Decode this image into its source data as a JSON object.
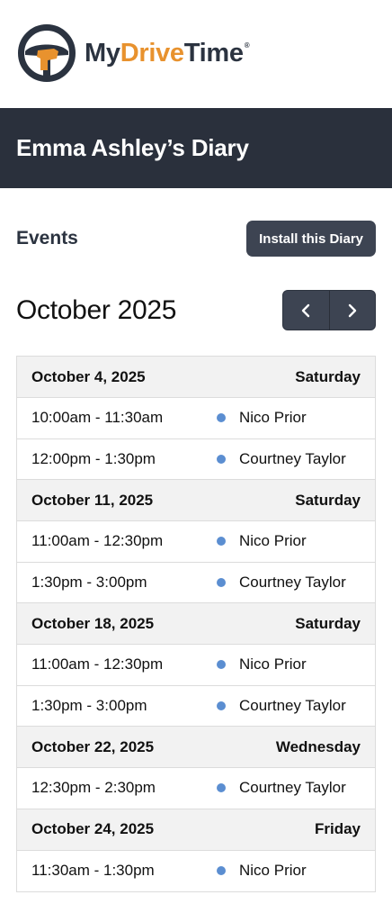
{
  "brand": {
    "name_part1": "My",
    "name_part2": "Drive",
    "name_part3": "Time",
    "registered": "®",
    "accent_color": "#e8922e",
    "dark_color": "#2b3340"
  },
  "header": {
    "title": "Emma Ashley’s Diary"
  },
  "toolbar": {
    "events_label": "Events",
    "install_label": "Install this Diary"
  },
  "calendar": {
    "month_label": "October 2025",
    "prev_icon": "chevron-left-icon",
    "next_icon": "chevron-right-icon"
  },
  "status_dot_color": "#5b8ed1",
  "days": [
    {
      "date": "October 4, 2025",
      "weekday": "Saturday",
      "events": [
        {
          "time": "10:00am - 11:30am",
          "name": "Nico Prior"
        },
        {
          "time": "12:00pm - 1:30pm",
          "name": "Courtney Taylor"
        }
      ]
    },
    {
      "date": "October 11, 2025",
      "weekday": "Saturday",
      "events": [
        {
          "time": "11:00am - 12:30pm",
          "name": "Nico Prior"
        },
        {
          "time": "1:30pm - 3:00pm",
          "name": "Courtney Taylor"
        }
      ]
    },
    {
      "date": "October 18, 2025",
      "weekday": "Saturday",
      "events": [
        {
          "time": "11:00am - 12:30pm",
          "name": "Nico Prior"
        },
        {
          "time": "1:30pm - 3:00pm",
          "name": "Courtney Taylor"
        }
      ]
    },
    {
      "date": "October 22, 2025",
      "weekday": "Wednesday",
      "events": [
        {
          "time": "12:30pm - 2:30pm",
          "name": "Courtney Taylor"
        }
      ]
    },
    {
      "date": "October 24, 2025",
      "weekday": "Friday",
      "events": [
        {
          "time": "11:30am - 1:30pm",
          "name": "Nico Prior"
        }
      ]
    }
  ]
}
